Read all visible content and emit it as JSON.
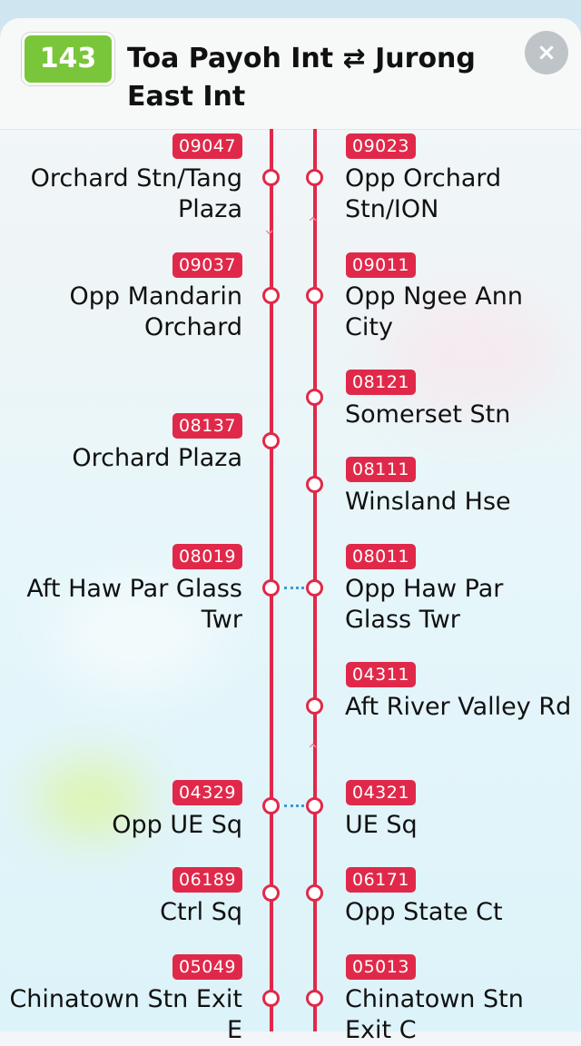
{
  "route": {
    "number": "143",
    "title": "Toa Payoh Int ⇄ Jurong East Int",
    "close_label": "×"
  },
  "colors": {
    "line": "#e0294a",
    "badge": "#7ac63a",
    "interchange": "#3a9ad9"
  },
  "stops_left": [
    {
      "code": "09047",
      "name": "Orchard Stn/Tang Plaza"
    },
    {
      "code": "09037",
      "name": "Opp Mandarin Orchard"
    },
    {
      "code": "08137",
      "name": "Orchard Plaza"
    },
    {
      "code": "08019",
      "name": "Aft Haw Par Glass Twr"
    },
    {
      "code": "04329",
      "name": "Opp UE Sq"
    },
    {
      "code": "06189",
      "name": "Ctrl Sq"
    },
    {
      "code": "05049",
      "name": "Chinatown Stn Exit E"
    }
  ],
  "stops_right": [
    {
      "code": "09023",
      "name": "Opp Orchard Stn/ION"
    },
    {
      "code": "09011",
      "name": "Opp Ngee Ann City"
    },
    {
      "code": "08121",
      "name": "Somerset Stn"
    },
    {
      "code": "08111",
      "name": "Winsland Hse"
    },
    {
      "code": "08011",
      "name": "Opp Haw Par Glass Twr"
    },
    {
      "code": "04311",
      "name": "Aft River Valley Rd"
    },
    {
      "code": "04321",
      "name": "UE Sq"
    },
    {
      "code": "06171",
      "name": "Opp State Ct"
    },
    {
      "code": "05013",
      "name": "Chinatown Stn Exit C"
    }
  ]
}
